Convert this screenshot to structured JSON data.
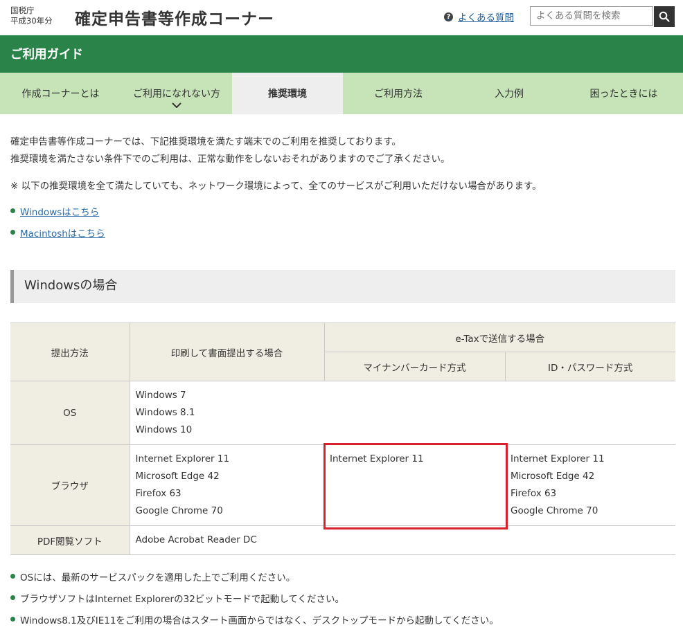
{
  "header": {
    "agency_line1": "国税庁",
    "agency_line2": "平成30年分",
    "site_title": "確定申告書等作成コーナー",
    "faq_icon": "?",
    "faq_link": "よくある質問",
    "search_placeholder": "よくある質問を検索"
  },
  "guide": {
    "title": "ご利用ガイド"
  },
  "tabs": [
    {
      "label": "作成コーナーとは"
    },
    {
      "label": "ご利用になれない方"
    },
    {
      "label": "推奨環境"
    },
    {
      "label": "ご利用方法"
    },
    {
      "label": "入力例"
    },
    {
      "label": "困ったときには"
    }
  ],
  "intro": {
    "line1": "確定申告書等作成コーナーでは、下記推奨環境を満たす端末でのご利用を推奨しております。",
    "line2": "推奨環境を満たさない条件下でのご利用は、正常な動作をしないおそれがありますのでご了承ください。",
    "note": "※  以下の推奨環境を全て満たしていても、ネットワーク環境によって、全てのサービスがご利用いただけない場合があります。"
  },
  "links": [
    {
      "label": "Windowsはこちら"
    },
    {
      "label": "Macintoshはこちら"
    }
  ],
  "section": {
    "heading": "Windowsの場合"
  },
  "table": {
    "h_method": "提出方法",
    "h_print": "印刷して書面提出する場合",
    "h_etax": "e-Taxで送信する場合",
    "h_mynumber": "マイナンバーカード方式",
    "h_idpw": "ID・パスワード方式",
    "r_os": "OS",
    "os": [
      "Windows 7",
      "Windows 8.1",
      "Windows 10"
    ],
    "r_browser": "ブラウザ",
    "browser_print": [
      "Internet Explorer 11",
      "Microsoft Edge 42",
      "Firefox 63",
      "Google Chrome 70"
    ],
    "browser_mynumber": [
      "Internet Explorer 11"
    ],
    "browser_idpw": [
      "Internet Explorer 11",
      "Microsoft Edge 42",
      "Firefox 63",
      "Google Chrome 70"
    ],
    "r_pdf": "PDF閲覧ソフト",
    "pdf": "Adobe Acrobat Reader DC"
  },
  "notes": [
    "OSには、最新のサービスパックを適用した上でご利用ください。",
    "ブラウザソフトはInternet Explorerの32ビットモードで起動してください。",
    "Windows8.1及びIE11をご利用の場合はスタート画面からではなく、デスクトップモードから起動してください。"
  ],
  "colors": {
    "brand_green": "#2a8449",
    "tab_green": "#c6e4b8",
    "highlight_red": "#d7202c"
  },
  "icons": {
    "search": "search-icon",
    "faq": "question-circle-icon",
    "tab_dropdown": "chevron-down-icon"
  }
}
